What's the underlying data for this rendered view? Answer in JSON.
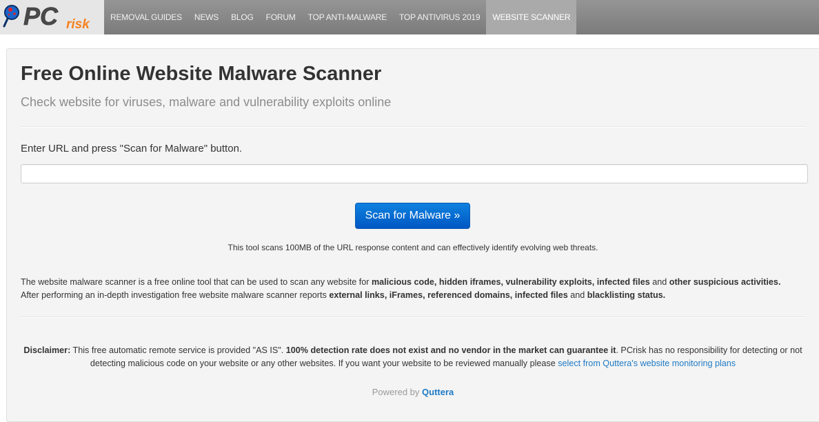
{
  "header": {
    "logo": {
      "primary": "PC",
      "secondary": "risk",
      "icon": "magnifier-virus-icon"
    },
    "nav": [
      {
        "label": "REMOVAL GUIDES",
        "active": false
      },
      {
        "label": "NEWS",
        "active": false
      },
      {
        "label": "BLOG",
        "active": false
      },
      {
        "label": "FORUM",
        "active": false
      },
      {
        "label": "TOP ANTI-MALWARE",
        "active": false
      },
      {
        "label": "TOP ANTIVIRUS 2019",
        "active": false
      },
      {
        "label": "WEBSITE SCANNER",
        "active": true
      }
    ]
  },
  "main": {
    "title": "Free Online Website Malware Scanner",
    "subtitle": "Check website for viruses, malware and vulnerability exploits online",
    "prompt": "Enter URL and press \"Scan for Malware\" button.",
    "url_input": {
      "value": "",
      "placeholder": ""
    },
    "scan_button": "Scan for Malware »",
    "tool_note": "This tool scans 100MB of the URL response content and can effectively identify evolving web threats.",
    "description": {
      "line1_prefix": "The website malware scanner is a free online tool that can be used to scan any website for ",
      "line1_bold1": "malicious code, hidden iframes, vulnerability exploits, infected files",
      "line1_mid": " and ",
      "line1_bold2": "other suspicious activities.",
      "line2_prefix": "After performing an in-depth investigation free website malware scanner reports ",
      "line2_bold1": "external links, iFrames, referenced domains, infected files",
      "line2_mid": " and ",
      "line2_bold2": "blacklisting status."
    },
    "disclaimer": {
      "label": "Disclaimer:",
      "text1": " This free automatic remote service is provided \"AS IS\". ",
      "bold": "100% detection rate does not exist and no vendor in the market can guarantee it",
      "text2": ". PCrisk has no responsibility for detecting or not detecting malicious code on your website or any other websites. If you want your website to be reviewed manually please ",
      "link": "select from Quttera's website monitoring plans"
    },
    "powered_by": {
      "prefix": "Powered by ",
      "brand": "Quttera"
    }
  },
  "colors": {
    "accent_button": "#0a6fd6",
    "link": "#1f7ac4",
    "logo_orange": "#f58220",
    "nav_bg": "#868686",
    "nav_active_bg": "#aaaaaa"
  }
}
